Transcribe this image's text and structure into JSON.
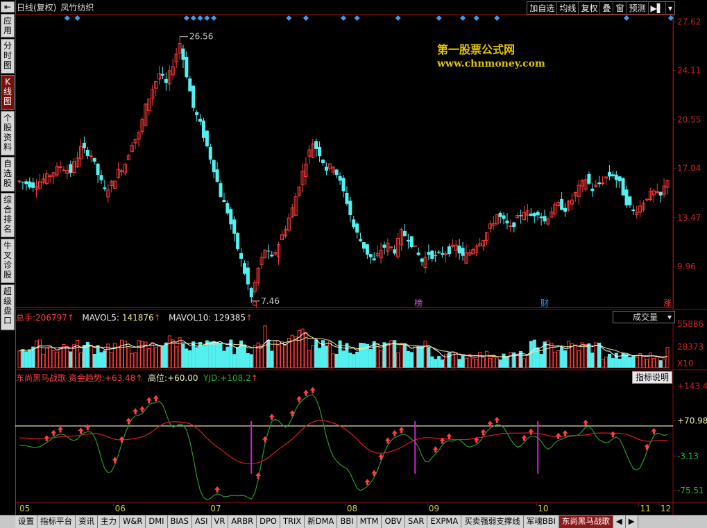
{
  "sidebar": {
    "items": [
      {
        "label": "应用"
      },
      {
        "label": "分时图"
      },
      {
        "label": "K线图"
      },
      {
        "label": "个股资料"
      },
      {
        "label": "自选股"
      },
      {
        "label": "综合排名"
      },
      {
        "label": "牛叉诊股"
      },
      {
        "label": "超级盘口"
      }
    ],
    "top_arrow": "⇤"
  },
  "header": {
    "period": "日线(复权)",
    "stock_name": "凤竹纺织"
  },
  "toolbar": {
    "buttons": [
      "加自选",
      "均线",
      "复权",
      "叠",
      "窗",
      "预测"
    ],
    "extra": [
      "▶▌",
      "▾"
    ]
  },
  "watermark": {
    "line1": "第一股票公式网",
    "line2": "www.chnmoney.com"
  },
  "price_axis": {
    "labels": [
      "27.62",
      "24.11",
      "20.55",
      "17.04",
      "13.47",
      "9.96"
    ],
    "high_label": "26.56",
    "low_label": "7.46",
    "markers": [
      "q",
      "榜",
      "财",
      "涨"
    ]
  },
  "volume_pane": {
    "total": {
      "label": "总手:",
      "value": "206797",
      "arrow": "↑"
    },
    "mavol5": {
      "label": "MAVOL5:",
      "value": "141876",
      "arrow": "↑"
    },
    "mavol10": {
      "label": "MAVOL10:",
      "value": "129385",
      "arrow": "↑"
    },
    "dropdown": "成交量",
    "axis_labels": [
      "55886",
      "28373",
      "X10"
    ]
  },
  "indicator_pane": {
    "name": "东尚黑马战歌",
    "trend": {
      "label": "资金趋势:",
      "value": "+63.48",
      "arrow": "↑"
    },
    "high": {
      "label": "高位:",
      "value": "+60.00"
    },
    "yjd": {
      "label": "YJD:",
      "value": "+108.2",
      "arrow": "↑"
    },
    "explain_button": "指标说明",
    "axis_labels": [
      "+143.4",
      "+70.98",
      "-3.13",
      "-75.51"
    ]
  },
  "time_axis": {
    "labels": [
      "05",
      "06",
      "07",
      "08",
      "09",
      "10",
      "11",
      "12"
    ]
  },
  "bottom_tabs": {
    "items": [
      "设置",
      "指标平台",
      "资讯",
      "主力",
      "W&R",
      "DMI",
      "BIAS",
      "ASI",
      "VR",
      "ARBR",
      "DPO",
      "TRIX",
      "新DMA",
      "BBI",
      "MTM",
      "OBV",
      "SAR",
      "EXPMA",
      "买卖强弱支撑线",
      "军魂BBI",
      "东尚黑马战歌"
    ],
    "active": "东尚黑马战歌",
    "nav": [
      "◀",
      "▶"
    ]
  },
  "colors": {
    "up": "#ff3b3b",
    "down": "#54f0f0",
    "ma5": "#ffffff",
    "ma10": "#f0e68c",
    "trend_line": "#2a9a2a",
    "red_line": "#d82020",
    "high_line": "#f5f5c0",
    "signal_arrow": "#ff4040",
    "magenta": "#d020d0",
    "diamond": "#3aa0f0"
  },
  "chart_data": {
    "type": "candlestick",
    "price_range": [
      7.0,
      28.2
    ],
    "month_labels": [
      "05",
      "06",
      "07",
      "08",
      "09",
      "10",
      "11",
      "12"
    ],
    "close_path": [
      [
        0,
        16.1
      ],
      [
        4,
        15.8
      ],
      [
        8,
        16.4
      ],
      [
        12,
        17.2
      ],
      [
        15,
        16.8
      ],
      [
        18,
        18.5
      ],
      [
        21,
        18.0
      ],
      [
        23,
        16.6
      ],
      [
        25,
        15.4
      ],
      [
        27,
        15.9
      ],
      [
        29,
        16.8
      ],
      [
        31,
        17.4
      ],
      [
        33,
        18.9
      ],
      [
        35,
        19.5
      ],
      [
        37,
        21.5
      ],
      [
        39,
        22.8
      ],
      [
        41,
        23.9
      ],
      [
        43,
        23.1
      ],
      [
        45,
        24.6
      ],
      [
        47,
        26.1
      ],
      [
        49,
        23.8
      ],
      [
        51,
        21.4
      ],
      [
        53,
        20.2
      ],
      [
        55,
        18.6
      ],
      [
        57,
        17.0
      ],
      [
        59,
        15.1
      ],
      [
        61,
        13.9
      ],
      [
        63,
        12.1
      ],
      [
        65,
        10.4
      ],
      [
        67,
        8.6
      ],
      [
        68,
        7.7
      ],
      [
        70,
        9.8
      ],
      [
        72,
        11.2
      ],
      [
        74,
        10.5
      ],
      [
        76,
        11.6
      ],
      [
        78,
        12.8
      ],
      [
        80,
        14.1
      ],
      [
        82,
        15.9
      ],
      [
        84,
        17.6
      ],
      [
        86,
        18.9
      ],
      [
        88,
        18.1
      ],
      [
        90,
        17.0
      ],
      [
        92,
        17.3
      ],
      [
        94,
        16.0
      ],
      [
        96,
        14.6
      ],
      [
        98,
        12.8
      ],
      [
        100,
        11.8
      ],
      [
        102,
        10.9
      ],
      [
        104,
        10.3
      ],
      [
        106,
        11.2
      ],
      [
        108,
        11.5
      ],
      [
        110,
        11.1
      ],
      [
        112,
        12.4
      ],
      [
        114,
        12.0
      ],
      [
        116,
        11.2
      ],
      [
        118,
        10.3
      ],
      [
        120,
        10.9
      ],
      [
        122,
        10.6
      ],
      [
        124,
        10.9
      ],
      [
        126,
        11.1
      ],
      [
        128,
        11.4
      ],
      [
        130,
        10.6
      ],
      [
        132,
        11.0
      ],
      [
        134,
        11.6
      ],
      [
        136,
        12.0
      ],
      [
        138,
        12.8
      ],
      [
        140,
        13.7
      ],
      [
        142,
        13.2
      ],
      [
        144,
        12.7
      ],
      [
        146,
        13.4
      ],
      [
        148,
        14.0
      ],
      [
        150,
        13.6
      ],
      [
        152,
        13.9
      ],
      [
        154,
        13.2
      ],
      [
        156,
        14.0
      ],
      [
        158,
        14.4
      ],
      [
        160,
        14.1
      ],
      [
        162,
        14.8
      ],
      [
        164,
        15.6
      ],
      [
        166,
        16.3
      ],
      [
        168,
        15.5
      ],
      [
        170,
        15.9
      ],
      [
        172,
        16.4
      ],
      [
        174,
        16.6
      ],
      [
        176,
        15.9
      ],
      [
        178,
        14.6
      ],
      [
        180,
        13.9
      ],
      [
        182,
        14.3
      ],
      [
        184,
        15.0
      ],
      [
        186,
        15.3
      ],
      [
        188,
        15.0
      ],
      [
        190,
        16.3
      ]
    ],
    "series": [
      {
        "name": "总手",
        "type": "volume"
      },
      {
        "name": "MAVOL5",
        "type": "line"
      },
      {
        "name": "MAVOL10",
        "type": "line"
      },
      {
        "name": "资金趋势",
        "type": "line"
      },
      {
        "name": "高位",
        "type": "line",
        "value": 60.0
      },
      {
        "name": "YJD",
        "type": "line"
      }
    ]
  }
}
